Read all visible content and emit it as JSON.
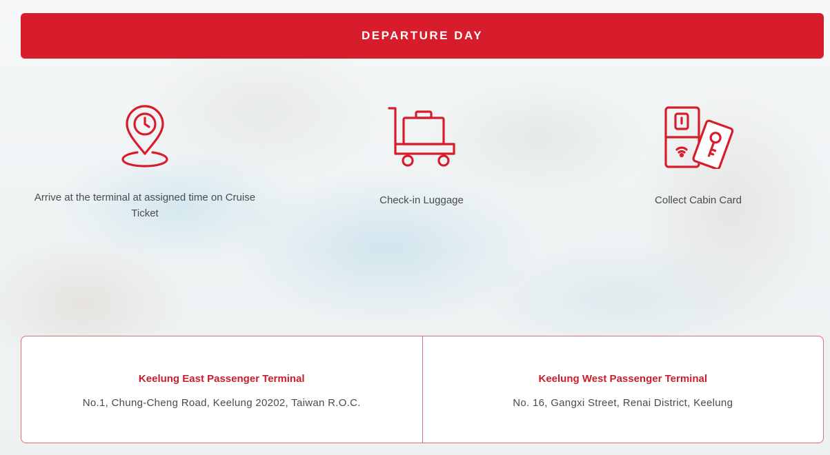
{
  "header": {
    "title": "DEPARTURE DAY"
  },
  "steps": [
    {
      "icon": "location-clock-pin-icon",
      "label": "Arrive at the terminal at assigned time on Cruise Ticket"
    },
    {
      "icon": "luggage-cart-icon",
      "label": "Check-in Luggage"
    },
    {
      "icon": "cabin-key-card-icon",
      "label": "Collect Cabin Card"
    }
  ],
  "terminals": [
    {
      "name": "Keelung East Passenger Terminal",
      "address": "No.1, Chung-Cheng Road, Keelung 20202, Taiwan R.O.C."
    },
    {
      "name": "Keelung West Passenger Terminal",
      "address": "No. 16, Gangxi Street, Renai District, Keelung"
    }
  ],
  "colors": {
    "accent": "#d71d2b",
    "text": "#4a4a4a",
    "white": "#ffffff"
  }
}
